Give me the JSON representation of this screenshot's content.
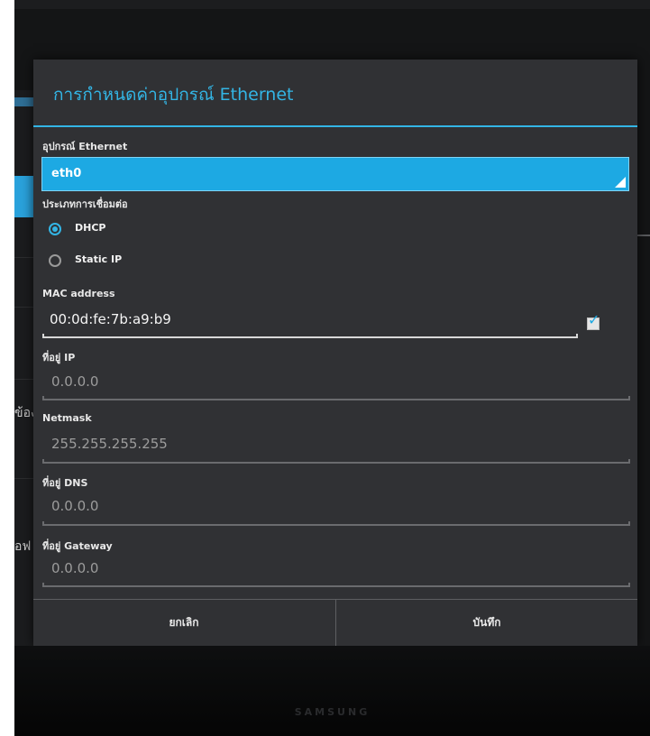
{
  "background": {
    "fragments": [
      "ข้อง",
      "อฟ"
    ]
  },
  "device_brand": "SAMSUNG",
  "dialog": {
    "title": "การกำหนดค่าอุปกรณ์ Ethernet",
    "device_label": "อุปกรณ์ Ethernet",
    "device_value": "eth0",
    "connection_type_label": "ประเภทการเชื่อมต่อ",
    "connection_options": [
      "DHCP",
      "Static IP"
    ],
    "connection_selected": "DHCP",
    "mac_label": "MAC address",
    "mac_value": "00:0d:fe:7b:a9:b9",
    "mac_checkbox_checked": true,
    "ip_label": "ที่อยู่ IP",
    "ip_value": "0.0.0.0",
    "netmask_label": "Netmask",
    "netmask_value": "255.255.255.255",
    "dns_label": "ที่อยู่ DNS",
    "dns_value": "0.0.0.0",
    "gateway_label": "ที่อยู่ Gateway",
    "gateway_value": "0.0.0.0",
    "cancel_label": "ยกเลิก",
    "save_label": "บันทึก"
  },
  "colors": {
    "accent": "#33b5e5",
    "dialog_bg": "#303134",
    "selected_field": "#1da9e3"
  }
}
